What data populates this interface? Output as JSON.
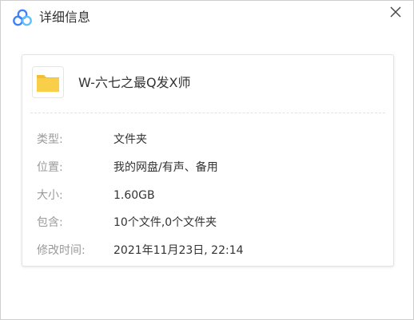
{
  "window": {
    "title": "详细信息",
    "logo_icon": "cloud-logo-icon",
    "close_icon": "close-icon"
  },
  "item": {
    "name": "W-六七之最Q发X师",
    "icon": "folder-icon",
    "icon_color": "#F9CF4A"
  },
  "details": [
    {
      "label": "类型:",
      "value": "文件夹"
    },
    {
      "label": "位置:",
      "value": "我的网盘/有声、备用"
    },
    {
      "label": "大小:",
      "value": "1.60GB"
    },
    {
      "label": "包含:",
      "value": "10个文件,0个文件夹"
    },
    {
      "label": "修改时间:",
      "value": "2021年11月23日, 22:14"
    }
  ],
  "colors": {
    "logo_primary": "#3E82F7",
    "logo_secondary": "#5FC0F9",
    "label_text": "#9a9a9a",
    "value_text": "#333333"
  }
}
